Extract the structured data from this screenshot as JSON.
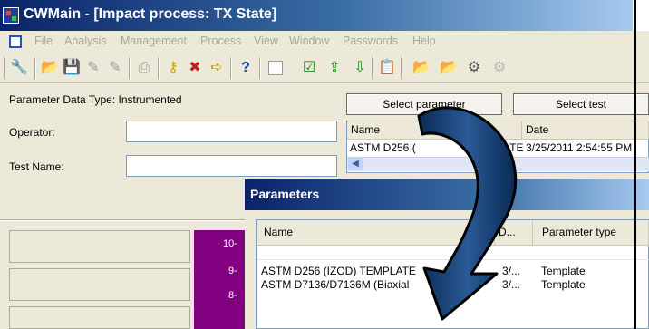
{
  "window": {
    "title": "CWMain - [Impact process: TX State]"
  },
  "menu": [
    "File",
    "Analysis",
    "Management",
    "Process",
    "View",
    "Window",
    "Passwords",
    "Help"
  ],
  "toolbar": {
    "icons": [
      "wrench-icon",
      "folder-open-icon",
      "save-icon",
      "edit-icon",
      "edit-icon",
      "print-icon",
      "key-icon",
      "key-remove-icon",
      "key-arrow-icon",
      "help-icon",
      "blank-icon",
      "checklist-icon",
      "folder-up-icon",
      "folder-down-icon",
      "clipboard-icon",
      "open-folder-icon",
      "open-folder-icon",
      "properties-icon",
      "properties-icon"
    ]
  },
  "form": {
    "param_type_label": "Parameter Data Type: Instrumented",
    "operator_label": "Operator:",
    "test_name_label": "Test Name:",
    "operator_value": "",
    "test_name_value": ""
  },
  "buttons": {
    "select_parameter": "Select parameter",
    "select_test": "Select test"
  },
  "list": {
    "columns": [
      "Name",
      "Date"
    ],
    "row": {
      "name": "ASTM D256 (",
      "suffix": "ATE",
      "date": "3/25/2011 2:54:55 PM"
    }
  },
  "chart": {
    "ticks": [
      "10-",
      "9-",
      "8-"
    ]
  },
  "dialog": {
    "title": "Parameters",
    "columns": [
      "Name",
      "D...",
      "Parameter type"
    ],
    "rows": [
      {
        "name": "ASTM D256 (IZOD) TEMPLATE",
        "date": "3/...",
        "type": "Template"
      },
      {
        "name": "ASTM D7136/D7136M (Biaxial",
        "date": "3/...",
        "type": "Template"
      }
    ]
  },
  "colors": {
    "titlebar": "#0a246a",
    "chart_bg": "#800080",
    "arrow": "#0d3a6e"
  }
}
